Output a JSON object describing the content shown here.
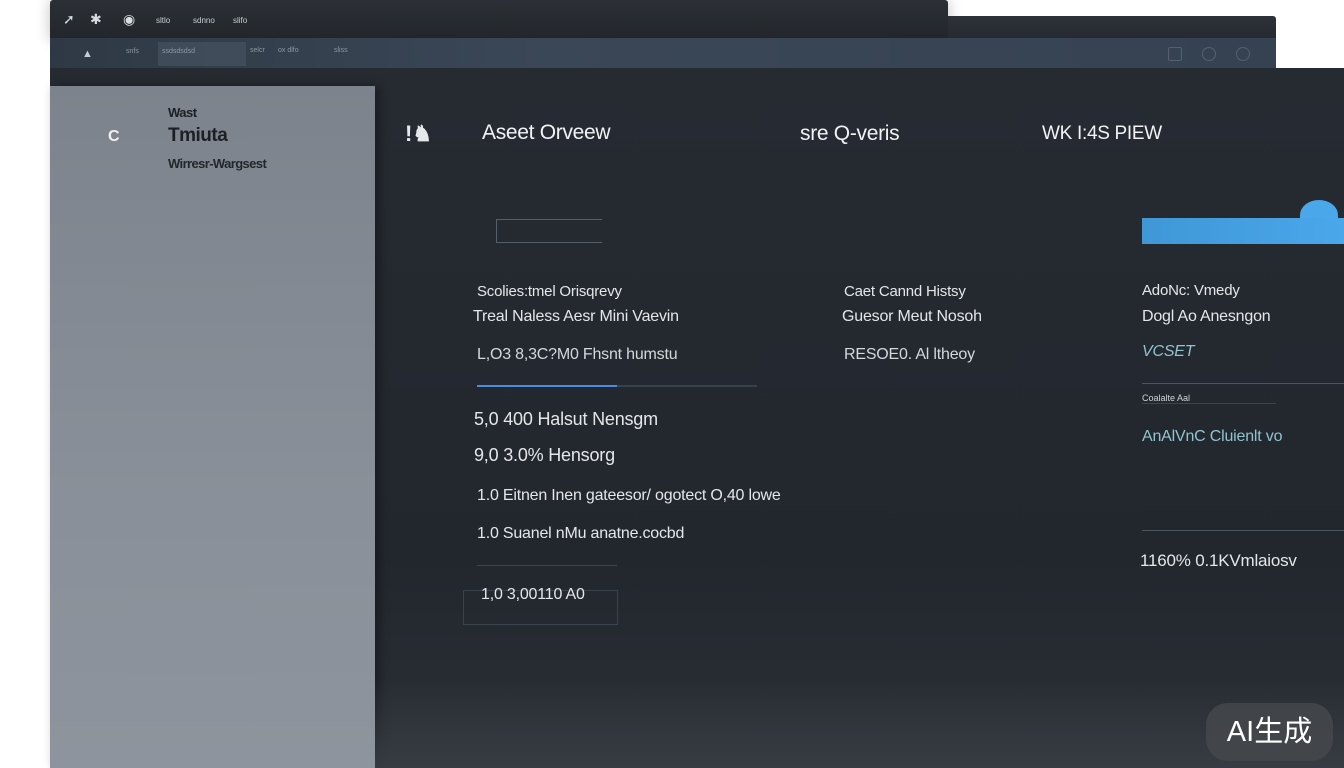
{
  "topbar": {
    "icons": [
      "arrow-icon",
      "star-icon",
      "globe-icon"
    ],
    "items": [
      "sltlo",
      "sdnno",
      "slifo"
    ]
  },
  "toolbar": {
    "labels": [
      "snfs",
      "ssdsdsdsd",
      "selcr",
      "ox dlfo",
      "sliss"
    ]
  },
  "sidebar": {
    "icon_letter": "C",
    "kicker": "Wast",
    "title": "Tmiuta",
    "subtitle": "Wirresr-Wargsest"
  },
  "header": {
    "asset_overview": "Aseet Orveew",
    "queries": "sre Q-veris",
    "preview": "WK I:4S PIEW"
  },
  "col1": {
    "heading1": "Scolies:tmel Orisqrevy",
    "heading2": "Treal Naless Aesr Mini Vaevin",
    "row1": "L,O3  8,3C?M0  Fhsnt humstu",
    "progress": 0.5,
    "row2": "5,0   400  Halsut Nensgm",
    "row3": "9,0   3.0%  Hensorg",
    "row4": "1.0   Eitnen Inen gateesor/ ogotect O,40 lowe",
    "row5": "1.0   Suanel nMu   anatne.cocbd",
    "box_value": "1,0   3,00110   A0"
  },
  "col2": {
    "heading1": "Caet Cannd Histsy",
    "heading2": "Guesor  Meut Nosoh",
    "row1": "RESOE0.  Al ltheoy"
  },
  "col3": {
    "heading1": "AdoNc: Vmedy",
    "heading2": "Dogl Ao Anesngon",
    "teal1": "VCSET",
    "small_label": "Coalalte Aal",
    "teal2": "AnAlVnC Cluienlt vo",
    "bottom": "1160%   0.1KVmlaiosv"
  },
  "watermark": "AI生成",
  "colors": {
    "accent": "#4aa7ea",
    "progress": "#4d8be0",
    "teal": "#8fc3cf"
  }
}
